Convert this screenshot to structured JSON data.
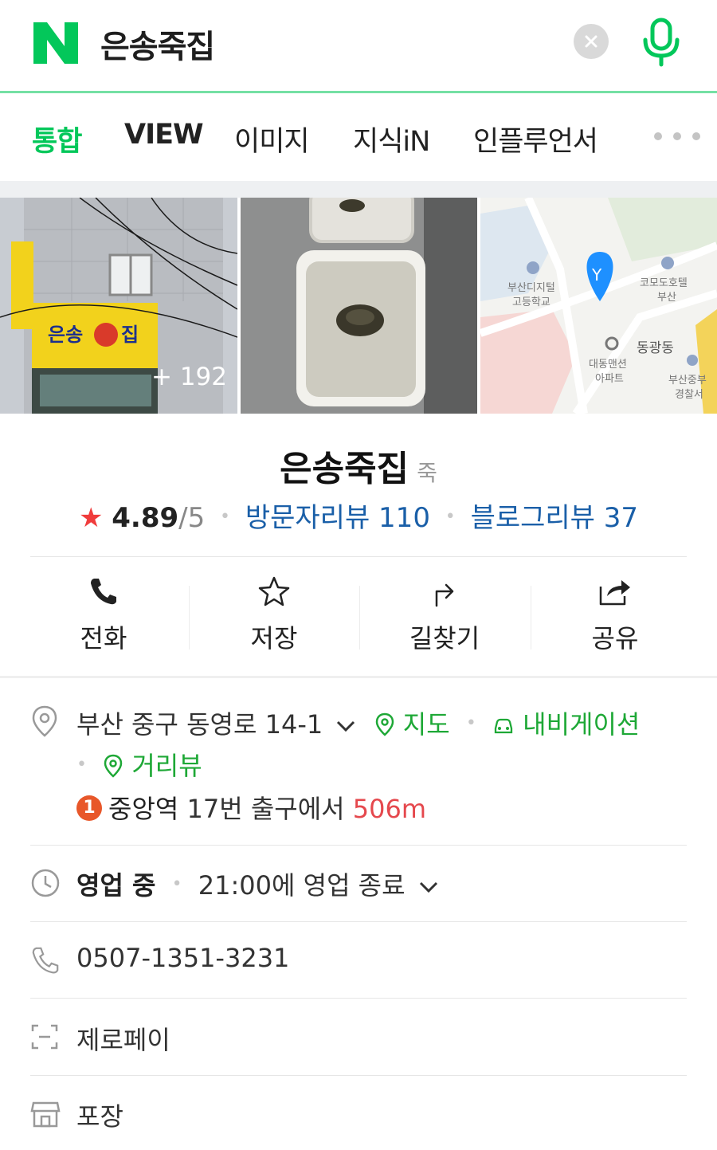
{
  "search": {
    "query": "은송죽집"
  },
  "tabs": [
    "통합",
    "VIEW",
    "이미지",
    "지식iN",
    "인플루언서"
  ],
  "photos": {
    "more_count": "+ 192"
  },
  "map_labels": [
    "부산디지털",
    "고등학교",
    "코모도호텔",
    "부산",
    "동광동",
    "대동맨션",
    "아파트",
    "부산중부",
    "경찰서"
  ],
  "place": {
    "name": "은송죽집",
    "category": "죽",
    "rating": "4.89",
    "rating_max": "/5",
    "visitor_reviews": "방문자리뷰 110",
    "blog_reviews": "블로그리뷰 37"
  },
  "actions": [
    "전화",
    "저장",
    "길찾기",
    "공유"
  ],
  "address": {
    "text": "부산 중구 동영로 14-1",
    "map_link": "지도",
    "nav_link": "내비게이션",
    "street_view": "거리뷰",
    "station_badge": "1",
    "station_name": "중앙역",
    "station_exit": "17번 출구에서",
    "distance": "506m"
  },
  "hours": {
    "status": "영업 중",
    "detail": "21:00에 영업 종료"
  },
  "phone": "0507-1351-3231",
  "payment": "제로페이",
  "takeout": "포장",
  "colors": {
    "naver_green": "#03c75a",
    "link_blue": "#1a5fa8",
    "star_red": "#f03c3c",
    "distance_red": "#e5484d"
  }
}
